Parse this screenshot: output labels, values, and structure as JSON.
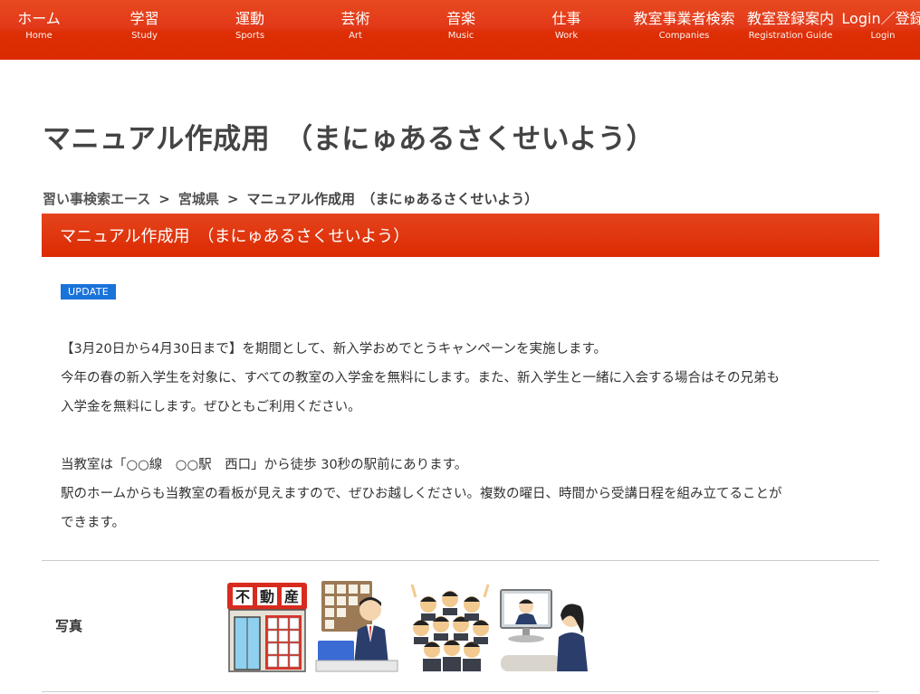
{
  "nav": [
    {
      "jp": "ホーム",
      "en": "Home"
    },
    {
      "jp": "学習",
      "en": "Study"
    },
    {
      "jp": "運動",
      "en": "Sports"
    },
    {
      "jp": "芸術",
      "en": "Art"
    },
    {
      "jp": "音楽",
      "en": "Music"
    },
    {
      "jp": "仕事",
      "en": "Work"
    },
    {
      "jp": "教室事業者検索",
      "en": "Companies"
    },
    {
      "jp": "教室登録案内",
      "en": "Registration Guide"
    },
    {
      "jp": "Login／登録",
      "en": "Login"
    }
  ],
  "page_title": "マニュアル作成用　（まにゅあるさくせいよう）",
  "breadcrumb": {
    "items": [
      "習い事検索エース",
      "宮城県",
      "マニュアル作成用　（まにゅあるさくせいよう）"
    ],
    "separator": ">"
  },
  "section_title": "マニュアル作成用　（まにゅあるさくせいよう）",
  "badge": "UPDATE",
  "body": {
    "line1": "【3月20日から4月30日まで】を期間として、新入学おめでとうキャンペーンを実施します。",
    "line2": "今年の春の新入学生を対象に、すべての教室の入学金を無料にします。また、新入学生と一緒に入会する場合はその兄弟も",
    "line3": "入学金を無料にします。ぜひともご利用ください。",
    "line4": "当教室は「○○線　○○駅　西口」から徒歩 30秒の駅前にあります。",
    "line5": "駅のホームからも当教室の看板が見えますので、ぜひお越しください。複数の曜日、時間から受講日程を組み立てることが",
    "line6": "できます。"
  },
  "photos": {
    "label": "写真",
    "sign_text": "不動産",
    "items": [
      "real-estate-shop-photo",
      "office-worker-photo",
      "cheering-group-photo",
      "video-call-photo"
    ]
  },
  "colors": {
    "nav_red": "#dc2a00",
    "badge_blue": "#1a73d9",
    "title_gray": "#444444"
  }
}
